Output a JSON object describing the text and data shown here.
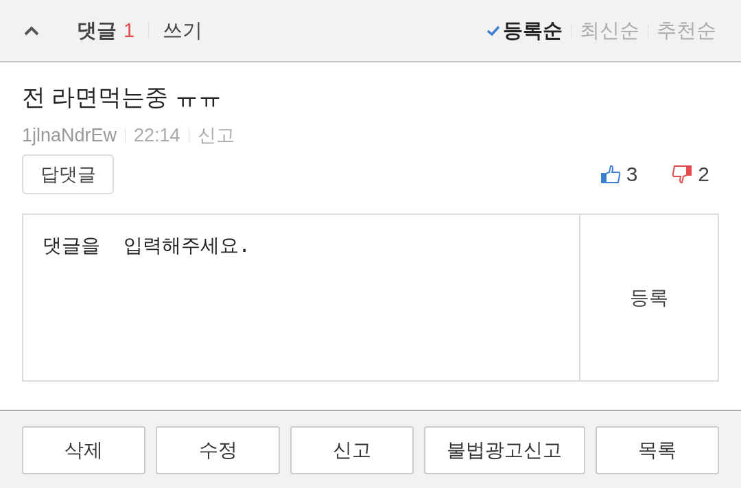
{
  "header": {
    "comment_label": "댓글",
    "comment_count": "1",
    "write_link": "쓰기",
    "sort_options": [
      {
        "label": "등록순",
        "selected": true
      },
      {
        "label": "최신순",
        "selected": false
      },
      {
        "label": "추천순",
        "selected": false
      }
    ]
  },
  "comment": {
    "text": "전 라면먹는중 ㅠㅠ",
    "author": "1jlnaNdrEw",
    "time": "22:14",
    "report": "신고",
    "reply_button": "답댓글",
    "likes": "3",
    "dislikes": "2"
  },
  "reply_form": {
    "placeholder": "댓글을  입력해주세요.",
    "submit": "등록"
  },
  "buttons": [
    "삭제",
    "수정",
    "신고",
    "불법광고신고",
    "목록"
  ]
}
